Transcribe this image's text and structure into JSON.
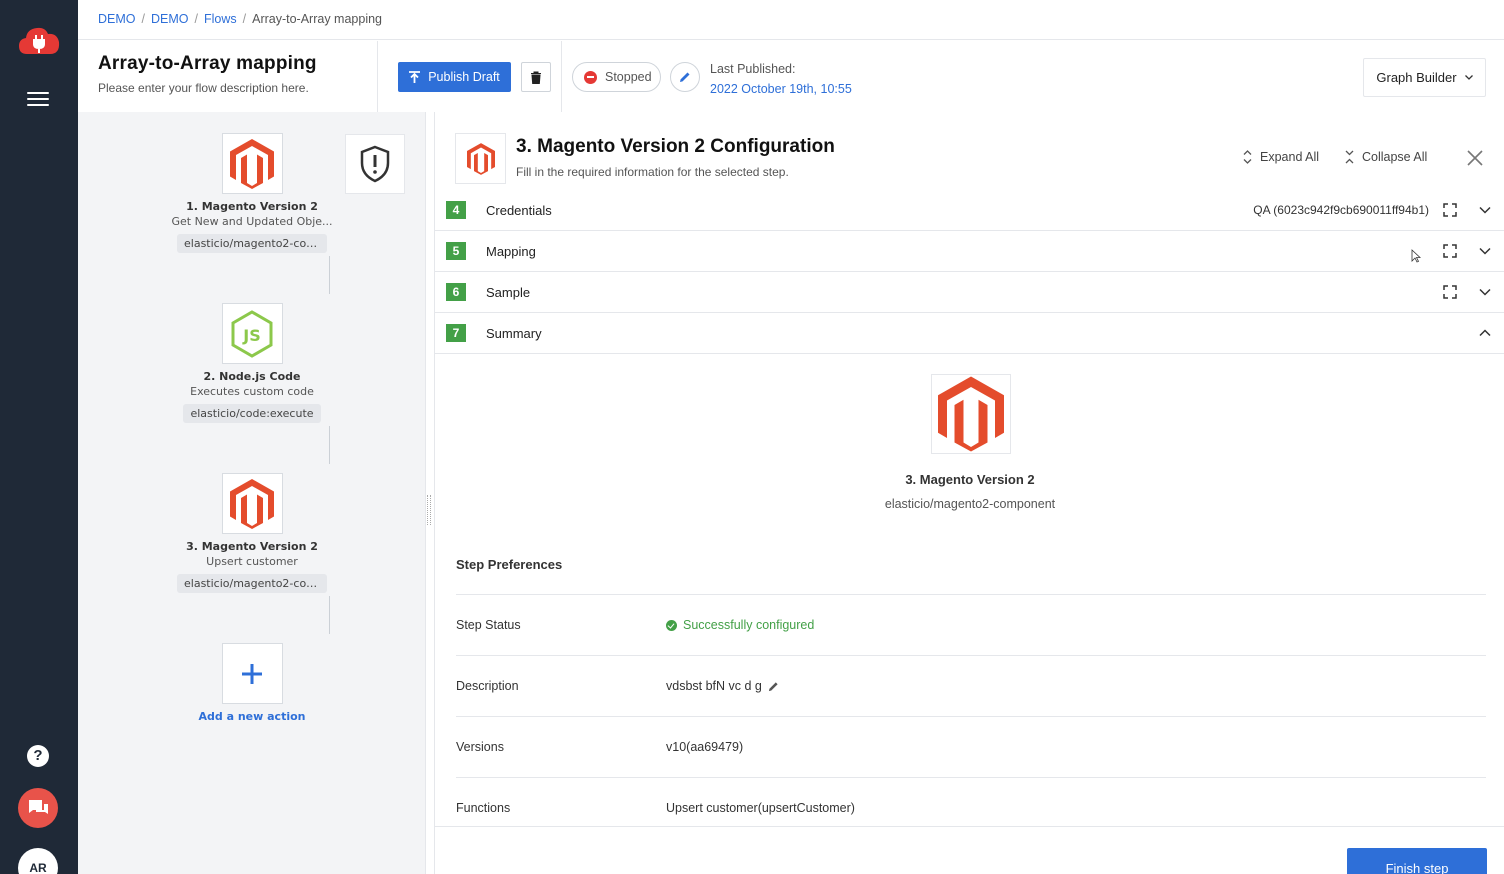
{
  "colors": {
    "rail": "#1f2937",
    "accent": "#2e6fd8",
    "success": "#43a047",
    "danger": "#e53935",
    "magento": "#e44c2c"
  },
  "rail": {
    "avatar_initials": "AR",
    "help_label": "?"
  },
  "breadcrumb": [
    {
      "label": "DEMO"
    },
    {
      "label": "DEMO"
    },
    {
      "label": "Flows"
    },
    {
      "label": "Array-to-Array mapping"
    }
  ],
  "flow": {
    "title": "Array-to-Array mapping",
    "description": "Please enter your flow description here."
  },
  "toolbar": {
    "publish_label": "Publish Draft",
    "status_label": "Stopped",
    "last_published_label": "Last Published:",
    "last_published_value": "2022 October 19th, 10:55",
    "view_mode": "Graph Builder"
  },
  "canvas": {
    "nodes": [
      {
        "name": "1. Magento Version 2",
        "desc": "Get New and Updated Obje...",
        "component": "elasticio/magento2-com..."
      },
      {
        "name": "2. Node.js Code",
        "desc": "Executes custom code",
        "component": "elasticio/code:execute"
      },
      {
        "name": "3. Magento Version 2",
        "desc": "Upsert customer",
        "component": "elasticio/magento2-com..."
      }
    ],
    "add_label": "Add a new action"
  },
  "panel": {
    "title": "3. Magento Version 2 Configuration",
    "subtitle": "Fill in the required information for the selected step.",
    "expand_all": "Expand All",
    "collapse_all": "Collapse All",
    "steps": [
      {
        "num": "4",
        "label": "Credentials",
        "extra": "QA (6023c942f9cb690011ff94b1)"
      },
      {
        "num": "5",
        "label": "Mapping",
        "extra": ""
      },
      {
        "num": "6",
        "label": "Sample",
        "extra": ""
      },
      {
        "num": "7",
        "label": "Summary",
        "extra": ""
      }
    ],
    "summary": {
      "component_name": "3. Magento Version 2",
      "component_id": "elasticio/magento2-component",
      "prefs_title": "Step Preferences",
      "prefs": [
        {
          "key": "Step Status",
          "value": "Successfully configured"
        },
        {
          "key": "Description",
          "value": "vdsbst bfN vc d g"
        },
        {
          "key": "Versions",
          "value": "v10(aa69479)"
        },
        {
          "key": "Functions",
          "value": "Upsert customer(upsertCustomer)"
        }
      ]
    },
    "finish_label": "Finish step"
  }
}
